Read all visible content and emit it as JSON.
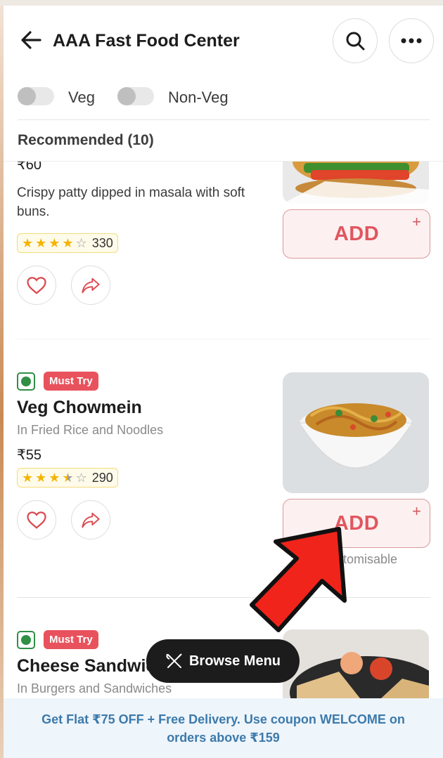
{
  "header": {
    "title": "AAA Fast Food Center",
    "veg_label": "Veg",
    "nonveg_label": "Non-Veg",
    "section_title": "Recommended (10)"
  },
  "dishes": [
    {
      "price": "₹60",
      "description": "Crispy patty dipped in masala with soft buns.",
      "rating_stars": 4,
      "rating_count": "330",
      "add_label": "ADD",
      "plus": "+"
    },
    {
      "badge": "Must Try",
      "name": "Veg Chowmein",
      "category": "In Fried Rice and Noodles",
      "price": "₹55",
      "rating_stars": 3.5,
      "rating_count": "290",
      "add_label": "ADD",
      "plus": "+",
      "customisable": "Customisable"
    },
    {
      "badge": "Must Try",
      "name": "Cheese Sandwich",
      "category": "In Burgers and Sandwiches"
    }
  ],
  "browse_menu": {
    "label": "Browse Menu"
  },
  "coupon": {
    "text": "Get Flat ₹75 OFF + Free Delivery. Use coupon WELCOME on orders above ₹159"
  },
  "colors": {
    "accent_red": "#e0575f",
    "veg_green": "#2f8f45",
    "coupon_blue": "#3d7aab"
  }
}
